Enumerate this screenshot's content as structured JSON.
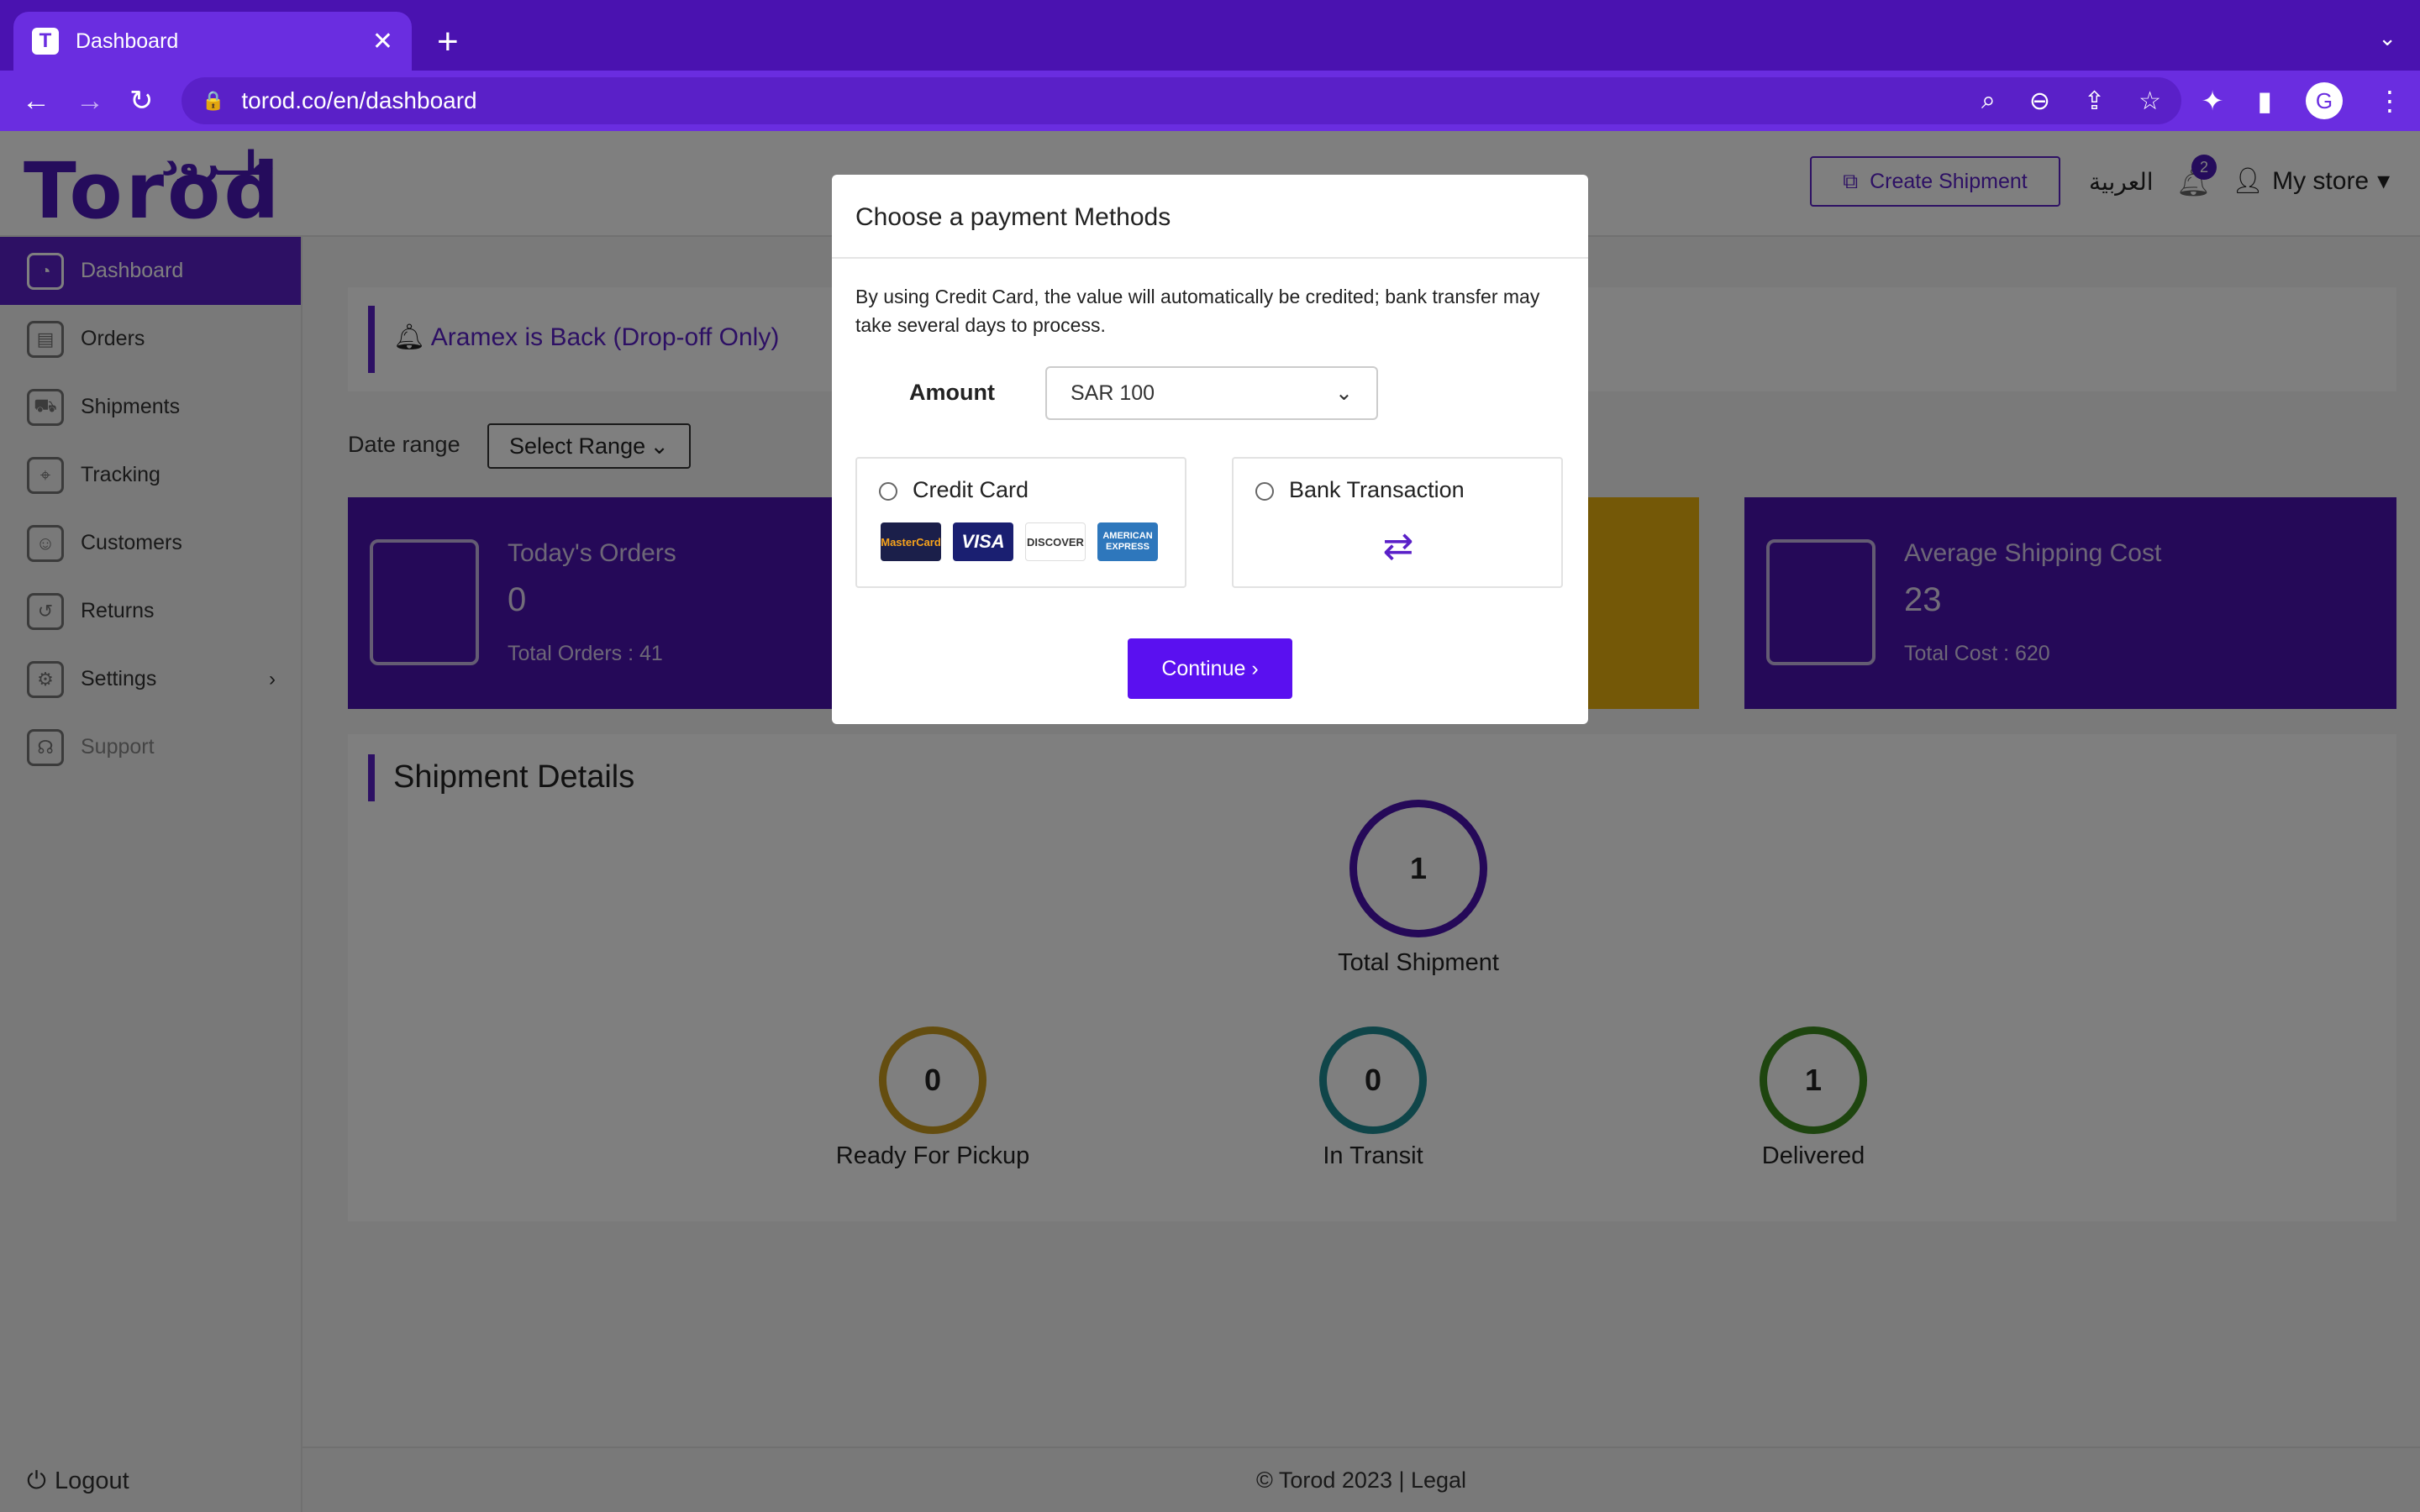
{
  "browser": {
    "tab_title": "Dashboard",
    "tab_close": "✕",
    "new_tab": "+",
    "url": "torod.co/en/dashboard",
    "avatar_letter": "G"
  },
  "header": {
    "logo_ar": "طــرود",
    "logo_en": "Torod",
    "create_shipment": "Create Shipment",
    "lang_switch": "العربية",
    "notification_count": "2",
    "store_menu": "My store"
  },
  "sidebar": {
    "items": [
      {
        "label": "Dashboard"
      },
      {
        "label": "Orders"
      },
      {
        "label": "Shipments"
      },
      {
        "label": "Tracking"
      },
      {
        "label": "Customers"
      },
      {
        "label": "Returns"
      },
      {
        "label": "Settings"
      },
      {
        "label": "Support"
      }
    ],
    "logout": "Logout"
  },
  "main": {
    "alert": "Aramex is Back (Drop-off Only)",
    "date_range_label": "Date range",
    "date_range_value": "Select Range",
    "cards": [
      {
        "title": "Today's Orders",
        "value": "0",
        "sub": "Total Orders : 41",
        "color": "#4a12b0"
      },
      {
        "title": "",
        "value": "",
        "sub": "",
        "color": "#e8b10f"
      },
      {
        "title": "Average Shipping Cost",
        "value": "23",
        "sub": "Total Cost : 620",
        "color": "#4a12b0"
      }
    ],
    "shipment_details": {
      "title": "Shipment Details",
      "total": {
        "value": "1",
        "label": "Total Shipment",
        "color": "#4a12b0"
      },
      "ready": {
        "value": "0",
        "label": "Ready For Pickup",
        "color": "#c99a1e"
      },
      "transit": {
        "value": "0",
        "label": "In Transit",
        "color": "#1f8a93"
      },
      "delivered": {
        "value": "1",
        "label": "Delivered",
        "color": "#3d8a1e"
      }
    }
  },
  "footer": "© Torod 2023 | Legal",
  "modal": {
    "title": "Choose a payment Methods",
    "description": "By using Credit Card, the value will automatically be credited; bank transfer may take several days to process.",
    "amount_label": "Amount",
    "amount_value": "SAR 100",
    "credit_card_label": "Credit Card",
    "card_logos": [
      "MasterCard",
      "VISA",
      "DISCOVER",
      "AMERICAN EXPRESS"
    ],
    "bank_label": "Bank Transaction",
    "continue_label": "Continue ›"
  }
}
